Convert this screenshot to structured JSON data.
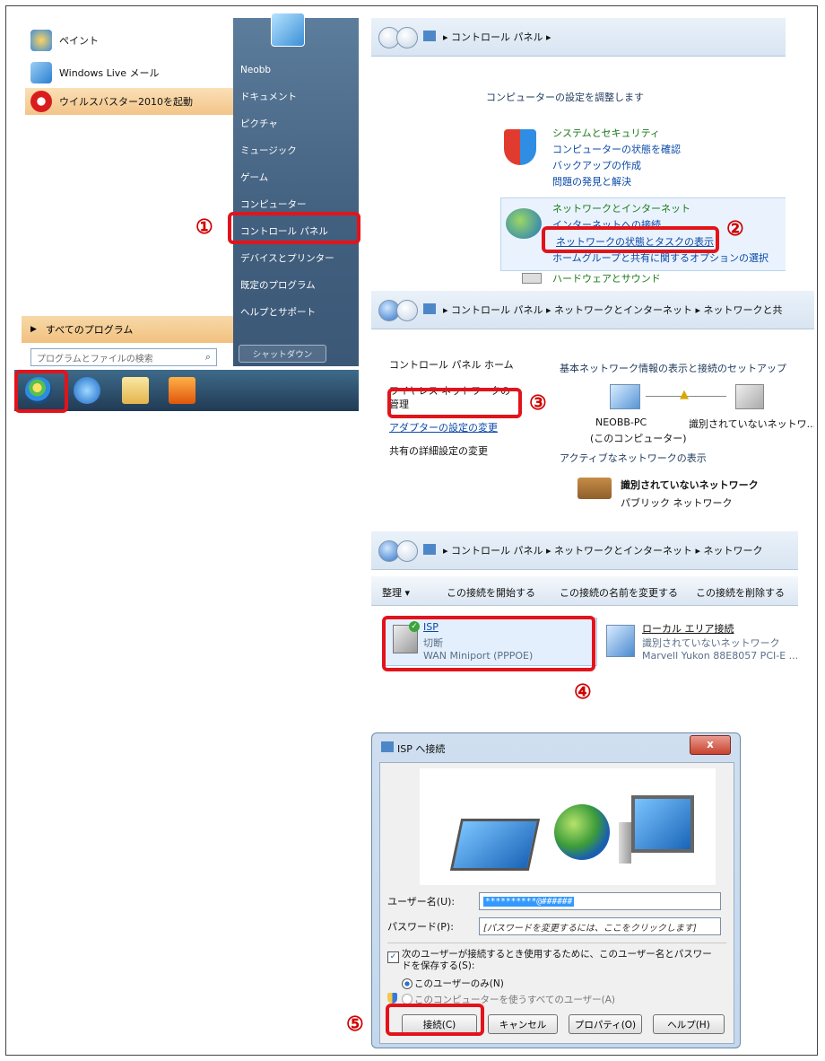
{
  "steps": [
    "①",
    "②",
    "③",
    "④",
    "⑤"
  ],
  "start_menu": {
    "left_items": [
      "ペイント",
      "Windows Live メール",
      "ウイルスバスター2010を起動"
    ],
    "right_items": [
      "Neobb",
      "ドキュメント",
      "ピクチャ",
      "ミュージック",
      "ゲーム",
      "コンピューター",
      "コントロール パネル",
      "デバイスとプリンター",
      "既定のプログラム",
      "ヘルプとサポート"
    ],
    "all_programs": "すべてのプログラム",
    "search_placeholder": "プログラムとファイルの検索",
    "shutdown": "シャットダウン"
  },
  "control_panel": {
    "breadcrumb": "コントロール パネル",
    "heading": "コンピューターの設定を調整します",
    "system_title": "システムとセキュリティ",
    "system_links": [
      "コンピューターの状態を確認",
      "バックアップの作成",
      "問題の発見と解決"
    ],
    "network_title": "ネットワークとインターネット",
    "network_links": [
      "インターネットへの接続",
      "ネットワークの状態とタスクの表示",
      "ホームグループと共有に関するオプションの選択"
    ],
    "hardware_title": "ハードウェアとサウンド"
  },
  "network_center": {
    "breadcrumb": "コントロール パネル  ▸  ネットワークとインターネット  ▸  ネットワークと共",
    "sidebar": [
      "コントロール パネル ホーム",
      "ワイヤレス ネットワークの管理",
      "アダプターの設定の変更",
      "共有の詳細設定の変更"
    ],
    "main_title": "基本ネットワーク情報の表示と接続のセットアップ",
    "pc_name": "NEOBB-PC",
    "pc_sub": "(このコンピューター)",
    "unidentified": "識別されていないネットワ...",
    "active_title": "アクティブなネットワークの表示",
    "net_name": "識別されていないネットワーク",
    "net_type": "パブリック ネットワーク"
  },
  "connections": {
    "breadcrumb": "コントロール パネル  ▸  ネットワークとインターネット  ▸  ネットワーク",
    "toolbar": [
      "整理 ▾",
      "この接続を開始する",
      "この接続の名前を変更する",
      "この接続を削除する"
    ],
    "isp_name": "ISP",
    "isp_status": "切断",
    "isp_device": "WAN Miniport (PPPOE)",
    "lan_name": "ローカル エリア接続",
    "lan_status": "識別されていないネットワーク",
    "lan_device": "Marvell Yukon 88E8057 PCI-E ..."
  },
  "dialog": {
    "title": "ISP へ接続",
    "close": "x",
    "username_label": "ユーザー名(U):",
    "username_value": "**********@######",
    "password_label": "パスワード(P):",
    "password_placeholder": "[パスワードを変更するには、ここをクリックします]",
    "save_label": "次のユーザーが接続するとき使用するために、このユーザー名とパスワードを保存する(S):",
    "radio_me": "このユーザーのみ(N)",
    "radio_all": "このコンピューターを使うすべてのユーザー(A)",
    "buttons": [
      "接続(C)",
      "キャンセル",
      "プロパティ(O)",
      "ヘルプ(H)"
    ]
  }
}
